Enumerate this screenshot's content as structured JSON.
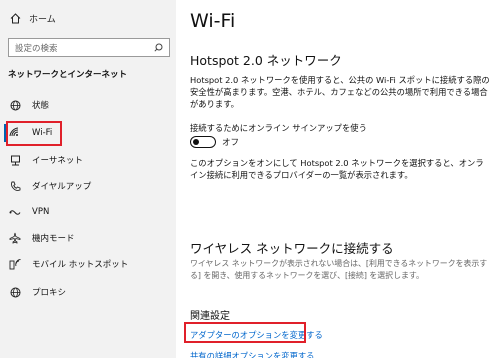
{
  "sidebar": {
    "home_label": "ホーム",
    "search_placeholder": "設定の検索",
    "section_title": "ネットワークとインターネット",
    "items": [
      {
        "label": "状態",
        "icon": "globe-icon"
      },
      {
        "label": "Wi-Fi",
        "icon": "wifi-icon"
      },
      {
        "label": "イーサネット",
        "icon": "ethernet-icon"
      },
      {
        "label": "ダイヤルアップ",
        "icon": "phone-icon"
      },
      {
        "label": "VPN",
        "icon": "vpn-icon"
      },
      {
        "label": "機内モード",
        "icon": "airplane-icon"
      },
      {
        "label": "モバイル ホットスポット",
        "icon": "hotspot-icon"
      },
      {
        "label": "プロキシ",
        "icon": "globe-icon"
      }
    ],
    "selected": "Wi-Fi"
  },
  "main": {
    "title": "Wi-Fi",
    "hotspot_heading": "Hotspot 2.0 ネットワーク",
    "hotspot_desc": "Hotspot 2.0 ネットワークを使用すると、公共の Wi-Fi スポットに接続する際の安全性が高まります。空港、ホテル、カフェなどの公共の場所で利用できる場合があります。",
    "toggle_label": "接続するためにオンライン サインアップを使う",
    "toggle_state": "オフ",
    "toggle_desc": "このオプションをオンにして Hotspot 2.0 ネットワークを選択すると、オンライン接続に利用できるプロバイダーの一覧が表示されます。",
    "wireless_heading": "ワイヤレス ネットワークに接続する",
    "wireless_desc": "ワイヤレス ネットワークが表示されない場合は、[利用できるネットワークを表示する] を開き、使用するネットワークを選び、[接続] を選択します。",
    "related_heading": "関連設定",
    "link_adapter": "アダプターのオプションを変更する",
    "link_sharing": "共有の詳細オプションを変更する"
  },
  "colors": {
    "sidebar_bg": "#f2f2f2",
    "accent": "#0063b1",
    "link": "#0066cc",
    "highlight_box": "#e0202a"
  }
}
